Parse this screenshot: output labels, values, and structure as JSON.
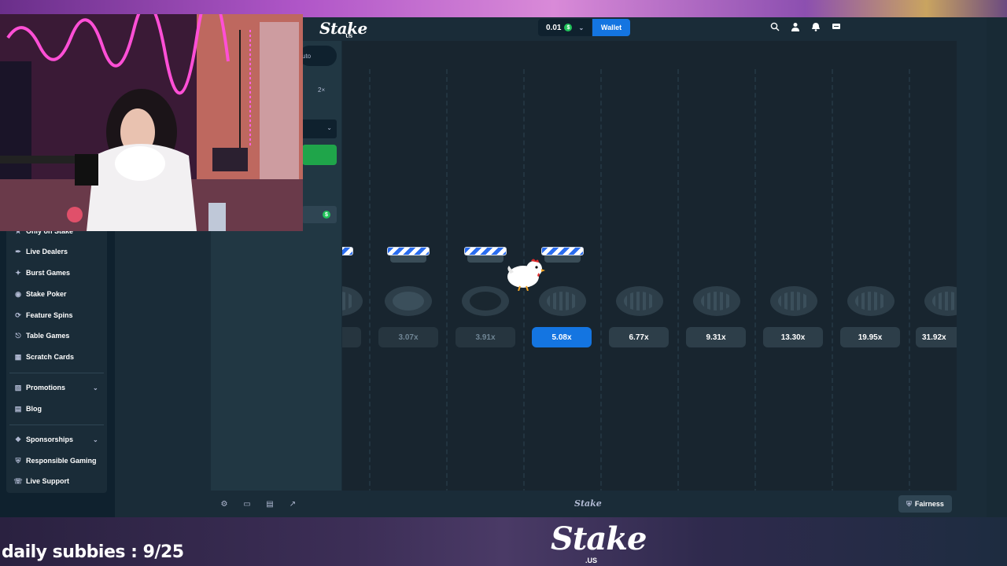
{
  "site": {
    "logo": "Stake",
    "logo_sub": "US",
    "balance": "0.01",
    "currency_symbol": "$",
    "wallet_label": "Wallet"
  },
  "controls": {
    "auto_label": "uto",
    "double_label": "2×"
  },
  "sidebar": {
    "items": [
      {
        "label": "Only on Stake",
        "icon": "star-icon"
      },
      {
        "label": "Live Dealers",
        "icon": "live-icon"
      },
      {
        "label": "Burst Games",
        "icon": "burst-icon"
      },
      {
        "label": "Stake Poker",
        "icon": "poker-icon"
      },
      {
        "label": "Feature Spins",
        "icon": "spins-icon"
      },
      {
        "label": "Table Games",
        "icon": "table-icon"
      },
      {
        "label": "Scratch Cards",
        "icon": "grid-icon"
      },
      {
        "label": "Promotions",
        "icon": "gift-icon"
      },
      {
        "label": "Blog",
        "icon": "blog-icon"
      },
      {
        "label": "Sponsorships",
        "icon": "handshake-icon"
      },
      {
        "label": "Responsible Gaming",
        "icon": "shield-icon"
      },
      {
        "label": "Live Support",
        "icon": "headset-icon"
      }
    ]
  },
  "game": {
    "multipliers": [
      "3.07x",
      "3.91x",
      "5.08x",
      "6.77x",
      "9.31x",
      "13.30x",
      "19.95x",
      "31.92x"
    ],
    "active_multiplier": "5.08x"
  },
  "footer": {
    "logo": "Stake",
    "fairness_label": "Fairness"
  },
  "overlay": {
    "subs_text": "daily subbies : 9/25",
    "brand": "Stake",
    "brand_sub": ".US"
  },
  "colors": {
    "accent_blue": "#1475e1",
    "play_green": "#1fa54a",
    "bg_dark": "#0f212e",
    "panel": "#1a2c38"
  }
}
